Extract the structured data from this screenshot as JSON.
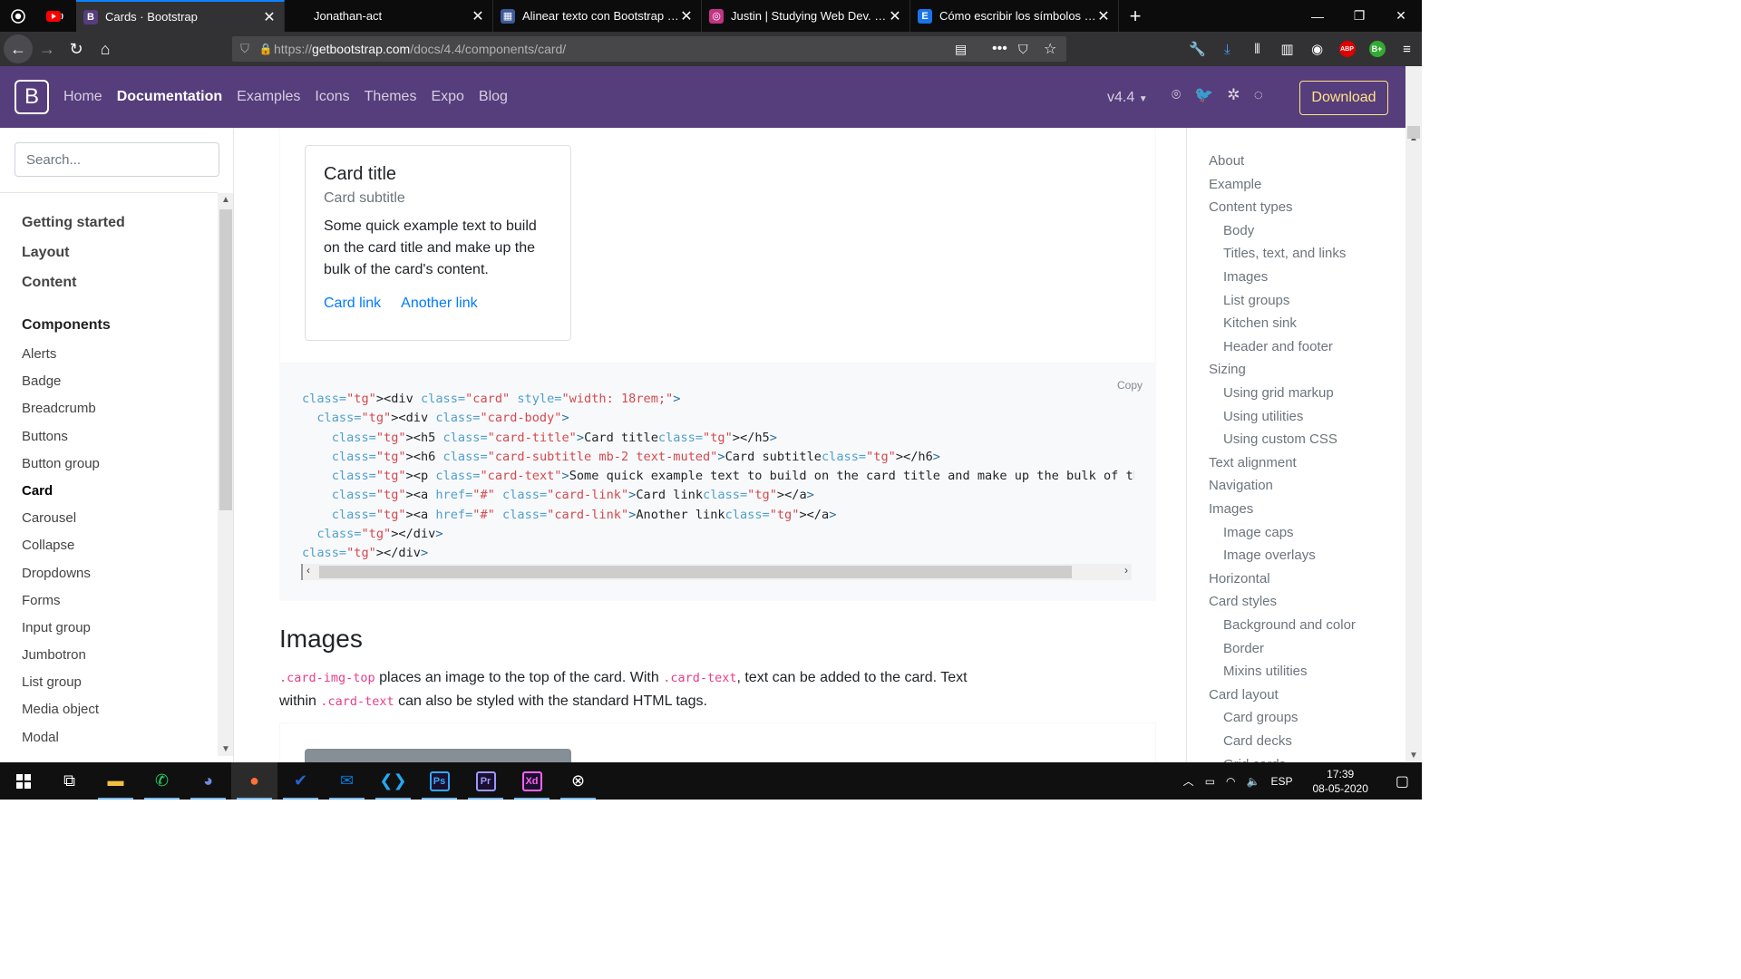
{
  "browser": {
    "tabs": [
      {
        "label": "Cards · Bootstrap",
        "favicon_color": "#563d7c",
        "favicon_glyph": "B",
        "active": true
      },
      {
        "label": "Jonathan-act",
        "favicon_color": "",
        "favicon_glyph": "",
        "active": false
      },
      {
        "label": "Alinear texto con Bootstrap - L",
        "favicon_color": "#3d5a99",
        "favicon_glyph": "▦",
        "active": false
      },
      {
        "label": "Justin | Studying Web Dev. (@c",
        "favicon_color": "#c13584",
        "favicon_glyph": "◎",
        "active": false
      },
      {
        "label": "Cómo escribir los símbolos Ma",
        "favicon_color": "#1a73e8",
        "favicon_glyph": "E",
        "active": false
      }
    ],
    "url": {
      "prefix": "https://",
      "domain": "getbootstrap.com",
      "path": "/docs/4.4/components/card/"
    }
  },
  "bd_nav": {
    "logo": "B",
    "links": [
      "Home",
      "Documentation",
      "Examples",
      "Icons",
      "Themes",
      "Expo",
      "Blog"
    ],
    "active_link": "Documentation",
    "version": "v4.4",
    "download_label": "Download",
    "accent": "#563d7c",
    "download_color": "#ffe484"
  },
  "sidebar": {
    "search_placeholder": "Search...",
    "groups": [
      "Getting started",
      "Layout",
      "Content"
    ],
    "components_title": "Components",
    "items": [
      "Alerts",
      "Badge",
      "Breadcrumb",
      "Buttons",
      "Button group",
      "Card",
      "Carousel",
      "Collapse",
      "Dropdowns",
      "Forms",
      "Input group",
      "Jumbotron",
      "List group",
      "Media object",
      "Modal"
    ],
    "active_item": "Card"
  },
  "example_card": {
    "title": "Card title",
    "subtitle": "Card subtitle",
    "text": "Some quick example text to build on the card title and make up the bulk of the card's content.",
    "link1": "Card link",
    "link2": "Another link"
  },
  "code_block": {
    "copy_label": "Copy",
    "lines": [
      "<div class=\"card\" style=\"width: 18rem;\">",
      "  <div class=\"card-body\">",
      "    <h5 class=\"card-title\">Card title</h5>",
      "    <h6 class=\"card-subtitle mb-2 text-muted\">Card subtitle</h6>",
      "    <p class=\"card-text\">Some quick example text to build on the card title and make up the bulk of the card's conten",
      "    <a href=\"#\" class=\"card-link\">Card link</a>",
      "    <a href=\"#\" class=\"card-link\">Another link</a>",
      "  </div>",
      "</div>"
    ]
  },
  "images_section": {
    "heading": "Images",
    "code1": ".card-img-top",
    "text1": " places an image to the top of the card. With ",
    "code2": ".card-text",
    "text2": ", text can be added to the card. Text within ",
    "code3": ".card-text",
    "text3": " can also be styled with the standard HTML tags."
  },
  "toc": [
    {
      "label": "About",
      "level": 1
    },
    {
      "label": "Example",
      "level": 1
    },
    {
      "label": "Content types",
      "level": 1
    },
    {
      "label": "Body",
      "level": 2
    },
    {
      "label": "Titles, text, and links",
      "level": 2
    },
    {
      "label": "Images",
      "level": 2
    },
    {
      "label": "List groups",
      "level": 2
    },
    {
      "label": "Kitchen sink",
      "level": 2
    },
    {
      "label": "Header and footer",
      "level": 2
    },
    {
      "label": "Sizing",
      "level": 1
    },
    {
      "label": "Using grid markup",
      "level": 2
    },
    {
      "label": "Using utilities",
      "level": 2
    },
    {
      "label": "Using custom CSS",
      "level": 2
    },
    {
      "label": "Text alignment",
      "level": 1
    },
    {
      "label": "Navigation",
      "level": 1
    },
    {
      "label": "Images",
      "level": 1
    },
    {
      "label": "Image caps",
      "level": 2
    },
    {
      "label": "Image overlays",
      "level": 2
    },
    {
      "label": "Horizontal",
      "level": 1
    },
    {
      "label": "Card styles",
      "level": 1
    },
    {
      "label": "Background and color",
      "level": 2
    },
    {
      "label": "Border",
      "level": 2
    },
    {
      "label": "Mixins utilities",
      "level": 2
    },
    {
      "label": "Card layout",
      "level": 1
    },
    {
      "label": "Card groups",
      "level": 2
    },
    {
      "label": "Card decks",
      "level": 2
    },
    {
      "label": "Grid cards",
      "level": 2
    }
  ],
  "taskbar": {
    "apps": [
      {
        "name": "task-view-icon",
        "glyph": "⧉",
        "color": ""
      },
      {
        "name": "file-explorer-icon",
        "glyph": "",
        "color": "#f0c040"
      },
      {
        "name": "whatsapp-icon",
        "glyph": "✆",
        "color": "#25d366"
      },
      {
        "name": "discord-icon",
        "glyph": "◕",
        "color": "#7289da"
      },
      {
        "name": "firefox-icon",
        "glyph": "●",
        "color": "#ff7139"
      },
      {
        "name": "todo-icon",
        "glyph": "✔",
        "color": "#2564cf"
      },
      {
        "name": "mail-icon",
        "glyph": "✉",
        "color": "#0078d4"
      },
      {
        "name": "vscode-icon",
        "glyph": "❮❯",
        "color": "#23a9f2"
      },
      {
        "name": "photoshop-icon",
        "glyph": "Ps",
        "color": "#31a8ff"
      },
      {
        "name": "premiere-icon",
        "glyph": "Pr",
        "color": "#9999ff"
      },
      {
        "name": "xd-icon",
        "glyph": "Xd",
        "color": "#ff61f6"
      },
      {
        "name": "xbox-icon",
        "glyph": "⊗",
        "color": "#ffffff"
      }
    ],
    "language": "ESP",
    "time": "17:39",
    "date": "08-05-2020"
  }
}
